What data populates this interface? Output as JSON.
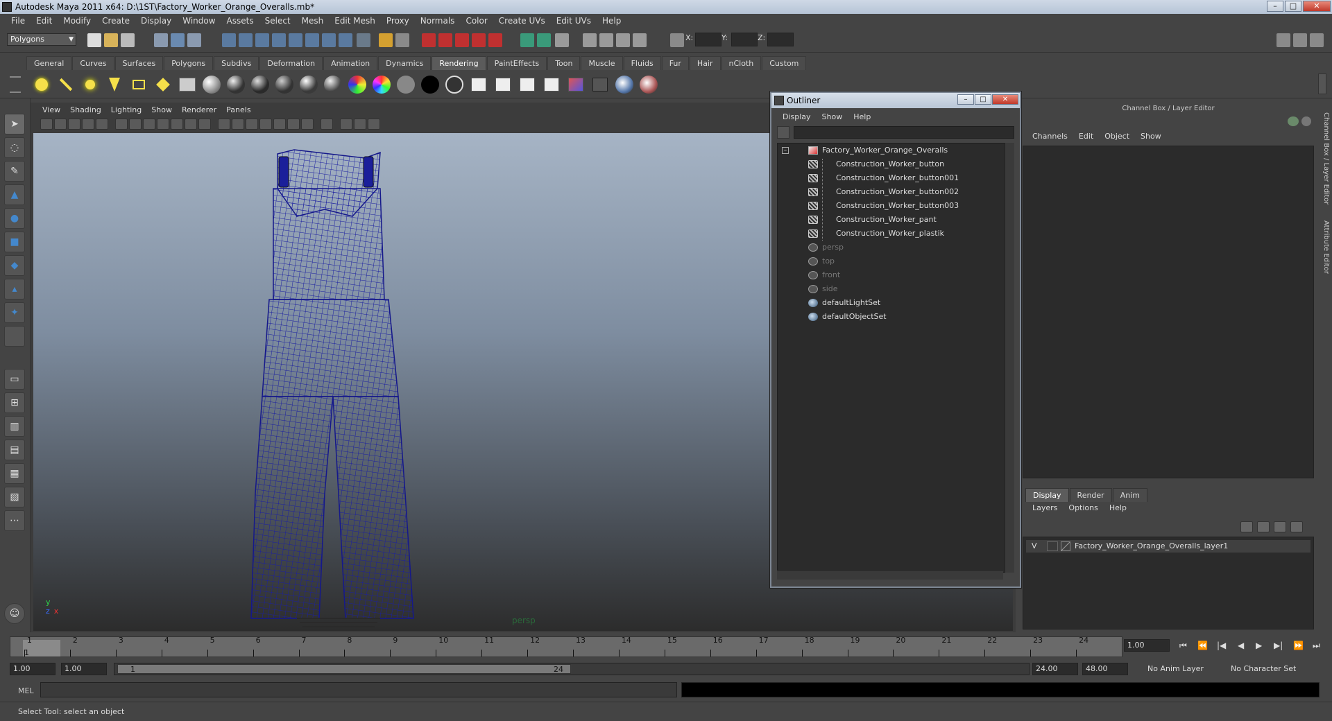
{
  "window": {
    "title": "Autodesk Maya 2011 x64: D:\\1ST\\Factory_Worker_Orange_Overalls.mb*",
    "minimize": "–",
    "maximize": "□",
    "close": "✕"
  },
  "menubar": [
    "File",
    "Edit",
    "Modify",
    "Create",
    "Display",
    "Window",
    "Assets",
    "Select",
    "Mesh",
    "Edit Mesh",
    "Proxy",
    "Normals",
    "Color",
    "Create UVs",
    "Edit UVs",
    "Help"
  ],
  "statusline": {
    "mode": "Polygons",
    "x_label": "X:",
    "y_label": "Y:",
    "z_label": "Z:"
  },
  "shelf": {
    "tabs": [
      "General",
      "Curves",
      "Surfaces",
      "Polygons",
      "Subdivs",
      "Deformation",
      "Animation",
      "Dynamics",
      "Rendering",
      "PaintEffects",
      "Toon",
      "Muscle",
      "Fluids",
      "Fur",
      "Hair",
      "nCloth",
      "Custom"
    ],
    "active_tab": "Rendering",
    "icons": [
      "ambient-light-icon",
      "directional-light-icon",
      "point-light-icon",
      "spot-light-icon",
      "area-light-icon",
      "volume-light-icon",
      "hypershade-icon",
      "lambert-sphere-icon",
      "blinn-sphere-icon",
      "phong-sphere-icon",
      "phong-e-sphere-icon",
      "anisotropic-sphere-icon",
      "layered-shader-icon",
      "ramp-shader-icon",
      "surface-shader-icon",
      "use-background-icon",
      "black-sphere-icon",
      "white-sphere-icon",
      "render-view-icon",
      "render-frame-icon",
      "ipr-render-icon",
      "render-settings-icon",
      "render-layer-icon",
      "batch-render-icon",
      "mental-ray-icon",
      "paint-effects-icon"
    ]
  },
  "viewport": {
    "menu": [
      "View",
      "Shading",
      "Lighting",
      "Show",
      "Renderer",
      "Panels"
    ],
    "camera_label": "persp",
    "axis_y": "y",
    "axis_x": "x",
    "axis_z": "z"
  },
  "outliner": {
    "title": "Outliner",
    "menu": [
      "Display",
      "Show",
      "Help"
    ],
    "root": "Factory_Worker_Orange_Overalls",
    "children": [
      "Construction_Worker_button",
      "Construction_Worker_button001",
      "Construction_Worker_button002",
      "Construction_Worker_button003",
      "Construction_Worker_pant",
      "Construction_Worker_plastik"
    ],
    "cameras": [
      "persp",
      "top",
      "front",
      "side"
    ],
    "sets": [
      "defaultLightSet",
      "defaultObjectSet"
    ],
    "expand": "–"
  },
  "channelbox": {
    "title": "Channel Box / Layer Editor",
    "menu": [
      "Channels",
      "Edit",
      "Object",
      "Show"
    ],
    "layer_tabs": [
      "Display",
      "Render",
      "Anim"
    ],
    "active_layer_tab": "Display",
    "layer_menu": [
      "Layers",
      "Options",
      "Help"
    ],
    "layer": {
      "visible": "V",
      "name": "Factory_Worker_Orange_Overalls_layer1"
    },
    "side_tabs": [
      "Channel Box / Layer Editor",
      "Attribute Editor"
    ]
  },
  "timeslider": {
    "ticks": [
      "1",
      "2",
      "3",
      "4",
      "5",
      "6",
      "7",
      "8",
      "9",
      "10",
      "11",
      "12",
      "13",
      "14",
      "15",
      "16",
      "17",
      "18",
      "19",
      "20",
      "21",
      "22",
      "23",
      "24"
    ],
    "current_frame": "1",
    "current_field": "1.00",
    "playback": [
      "⏮",
      "⏪",
      "|◀",
      "◀",
      "▶",
      "▶|",
      "⏩",
      "⏭"
    ]
  },
  "rangeslider": {
    "start_time": "1.00",
    "playback_start": "1.00",
    "range_start": "1",
    "range_end": "24",
    "playback_end": "24.00",
    "end_time": "48.00",
    "anim_layer": "No Anim Layer",
    "character_set": "No Character Set"
  },
  "cmdline": {
    "label": "MEL"
  },
  "helpline": {
    "text": "Select Tool: select an object"
  }
}
